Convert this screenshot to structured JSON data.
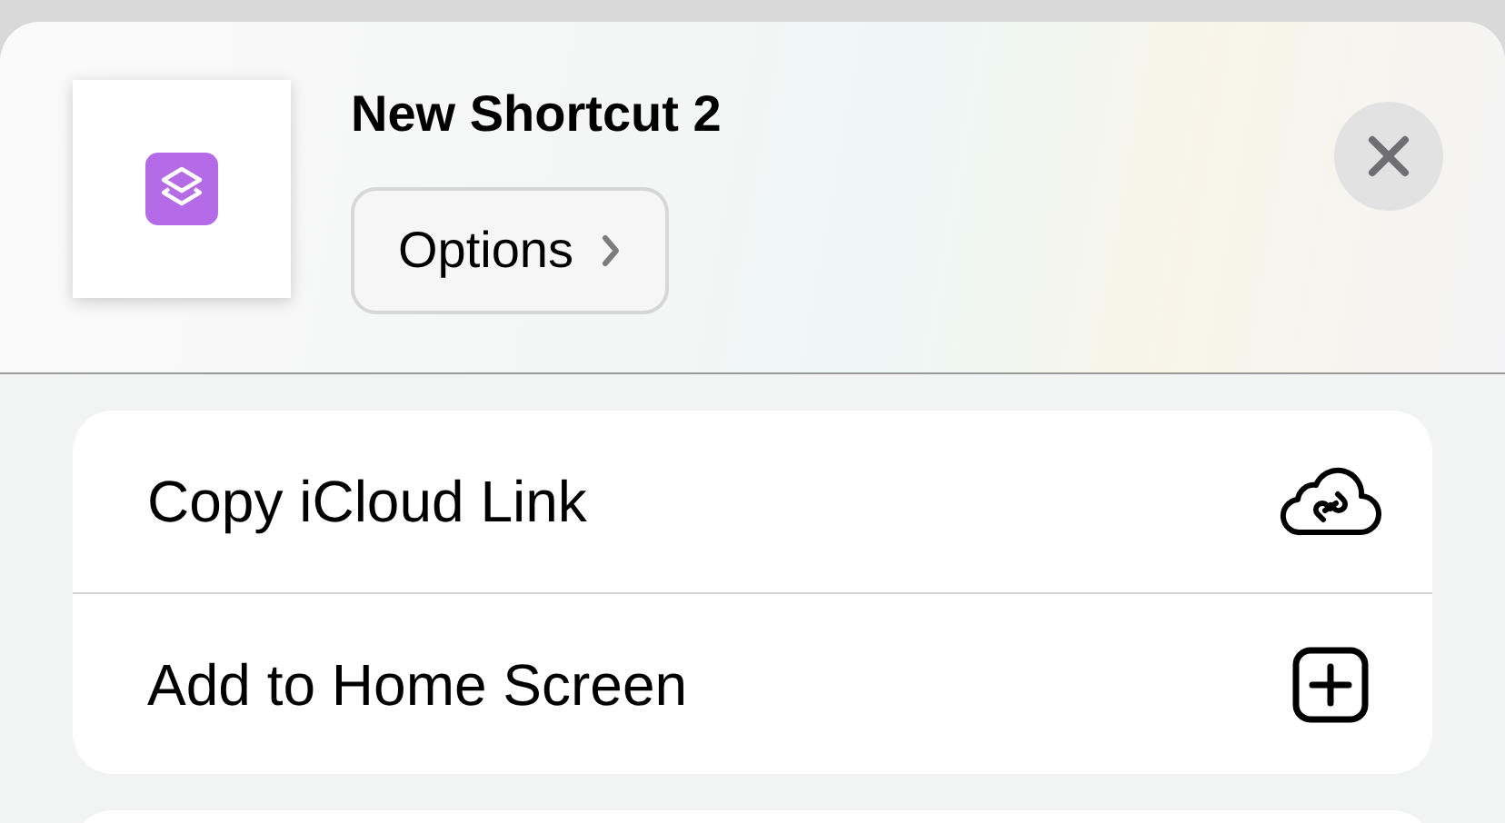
{
  "header": {
    "title": "New Shortcut 2",
    "options_button": {
      "label": "Options"
    }
  },
  "actions": [
    {
      "label": "Copy iCloud Link",
      "kind": "cloud-link"
    },
    {
      "label": "Add to Home Screen",
      "kind": "add-square"
    }
  ]
}
